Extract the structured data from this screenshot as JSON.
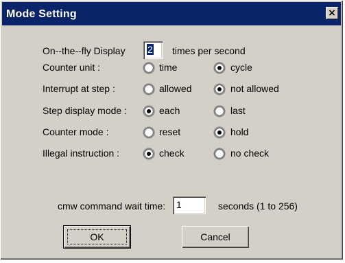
{
  "dialog": {
    "title": "Mode Setting",
    "close_glyph": "×",
    "close_icon": "close-icon"
  },
  "display": {
    "label": "On--the--fly Display",
    "value": "2",
    "suffix": "times per second"
  },
  "rows": [
    {
      "key": "counter_unit",
      "label": "Counter unit :",
      "options": [
        "time",
        "cycle"
      ],
      "selected": 1
    },
    {
      "key": "interrupt",
      "label": "Interrupt at step :",
      "options": [
        "allowed",
        "not allowed"
      ],
      "selected": 1
    },
    {
      "key": "step_display",
      "label": "Step display mode :",
      "options": [
        "each",
        "last"
      ],
      "selected": 0
    },
    {
      "key": "counter_mode",
      "label": "Counter mode :",
      "options": [
        "reset",
        "hold"
      ],
      "selected": 1
    },
    {
      "key": "illegal",
      "label": "Illegal instruction :",
      "options": [
        "check",
        "no check"
      ],
      "selected": 0
    }
  ],
  "wait": {
    "label": "cmw command wait time:",
    "value": "1",
    "suffix": "seconds (1 to 256)"
  },
  "buttons": {
    "ok": "OK",
    "cancel": "Cancel"
  },
  "colors": {
    "titlebar": "#0a246a",
    "face": "#d4d0c8"
  }
}
